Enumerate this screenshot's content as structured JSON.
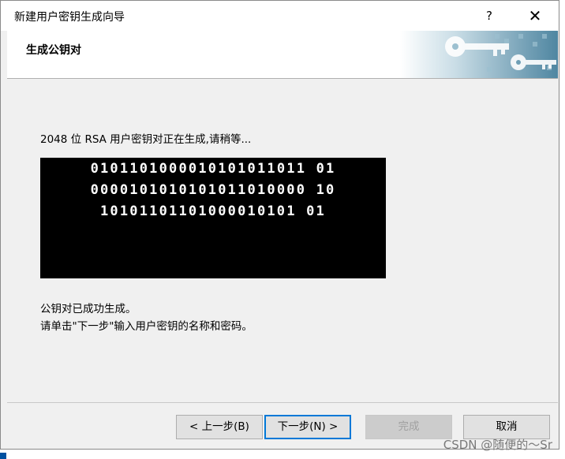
{
  "window": {
    "title": "新建用户密钥生成向导",
    "help_label": "?",
    "close_label": "✕"
  },
  "header": {
    "title": "生成公钥对",
    "art_icon": "keys-banner-icon"
  },
  "content": {
    "status": "2048 位 RSA 用户密钥对正在生成,请稍等...",
    "binary_lines": [
      "0101101000010101011011 01",
      "0000101010101011010000 10",
      "10101101101000010101 01"
    ],
    "success": "公钥对已成功生成。",
    "instruction": "请单击\"下一步\"输入用户密钥的名称和密码。"
  },
  "buttons": {
    "prev": "< 上一步(B)",
    "next": "下一步(N) >",
    "finish": "完成",
    "cancel": "取消"
  },
  "watermark": "CSDN @随便的～Sr",
  "colors": {
    "focus_border": "#0078d7",
    "binary_bg": "#000000",
    "banner_blue": "#6f9fb5"
  }
}
